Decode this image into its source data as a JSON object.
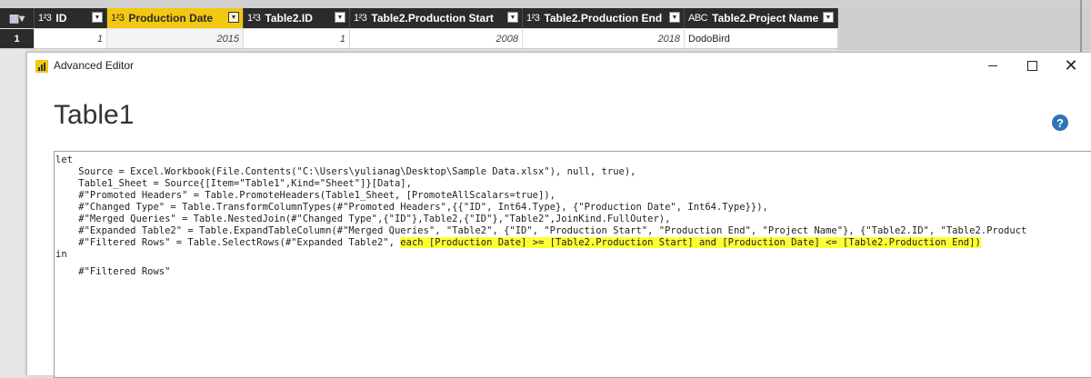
{
  "grid": {
    "columns": [
      {
        "type": "1²3",
        "label": "ID"
      },
      {
        "type": "1²3",
        "label": "Production Date"
      },
      {
        "type": "1²3",
        "label": "Table2.ID"
      },
      {
        "type": "1²3",
        "label": "Table2.Production Start"
      },
      {
        "type": "1²3",
        "label": "Table2.Production End"
      },
      {
        "type": "ABC",
        "label": "Table2.Project Name"
      }
    ],
    "rows": [
      {
        "num": "1",
        "cells": [
          "1",
          "2015",
          "1",
          "2008",
          "2018",
          "DodoBird"
        ]
      }
    ],
    "active_column": "Production Date"
  },
  "editor": {
    "window_title": "Advanced Editor",
    "query_name": "Table1",
    "help_label": "?",
    "code": {
      "l0": "let",
      "l1": "    Source = Excel.Workbook(File.Contents(\"C:\\Users\\yulianag\\Desktop\\Sample Data.xlsx\"), null, true),",
      "l2": "    Table1_Sheet = Source{[Item=\"Table1\",Kind=\"Sheet\"]}[Data],",
      "l3": "    #\"Promoted Headers\" = Table.PromoteHeaders(Table1_Sheet, [PromoteAllScalars=true]),",
      "l4": "    #\"Changed Type\" = Table.TransformColumnTypes(#\"Promoted Headers\",{{\"ID\", Int64.Type}, {\"Production Date\", Int64.Type}}),",
      "l5": "    #\"Merged Queries\" = Table.NestedJoin(#\"Changed Type\",{\"ID\"},Table2,{\"ID\"},\"Table2\",JoinKind.FullOuter),",
      "l6": "    #\"Expanded Table2\" = Table.ExpandTableColumn(#\"Merged Queries\", \"Table2\", {\"ID\", \"Production Start\", \"Production End\", \"Project Name\"}, {\"Table2.ID\", \"Table2.Product",
      "l7a": "    #\"Filtered Rows\" = Table.SelectRows(#\"Expanded Table2\", ",
      "l7b": "each [Production Date] >= [Table2.Production Start] and [Production Date] <= [Table2.Production End])",
      "l8": "in",
      "l9": "    #\"Filtered Rows\""
    }
  },
  "colors": {
    "highlight": "#ffff33",
    "active_column": "#f2c811",
    "header_bg": "#2b2b2b",
    "help_icon": "#2e75b6"
  }
}
